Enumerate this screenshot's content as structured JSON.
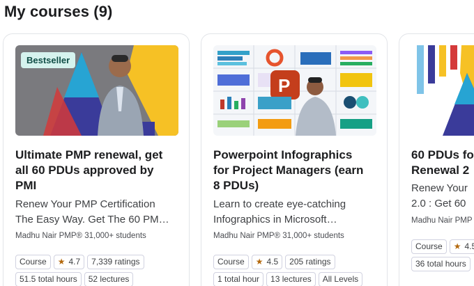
{
  "page": {
    "title": "My courses (9)"
  },
  "courses": [
    {
      "badge": "Bestseller",
      "title_lines": [
        "Ultimate PMP renewal, get",
        "all 60 PDUs approved by",
        "PMI"
      ],
      "desc_lines": [
        "Renew Your PMP Certification",
        "The Easy Way. Get The 60 PM…"
      ],
      "author": "Madhu Nair PMP® 31,000+ students",
      "tag": "Course",
      "rating": "4.7",
      "ratings_count": "7,339 ratings",
      "hours": "51.5 total hours",
      "lectures": "52 lectures",
      "level": ""
    },
    {
      "badge": "",
      "title_lines": [
        "Powerpoint Infographics",
        "for Project Managers (earn",
        "8 PDUs)"
      ],
      "desc_lines": [
        "Learn to create eye-catching",
        "Infographics in Microsoft…"
      ],
      "author": "Madhu Nair PMP® 31,000+ students",
      "tag": "Course",
      "rating": "4.5",
      "ratings_count": "205 ratings",
      "hours": "1 total hour",
      "lectures": "13 lectures",
      "level": "All Levels"
    },
    {
      "badge": "",
      "title_lines": [
        "60 PDUs fo",
        "Renewal 2"
      ],
      "desc_lines": [
        "Renew Your",
        "2.0 : Get 60"
      ],
      "author": "Madhu Nair PMP",
      "tag": "Course",
      "rating": "4.5",
      "ratings_count": "",
      "hours": "36 total hours",
      "lectures": "",
      "level": ""
    }
  ]
}
